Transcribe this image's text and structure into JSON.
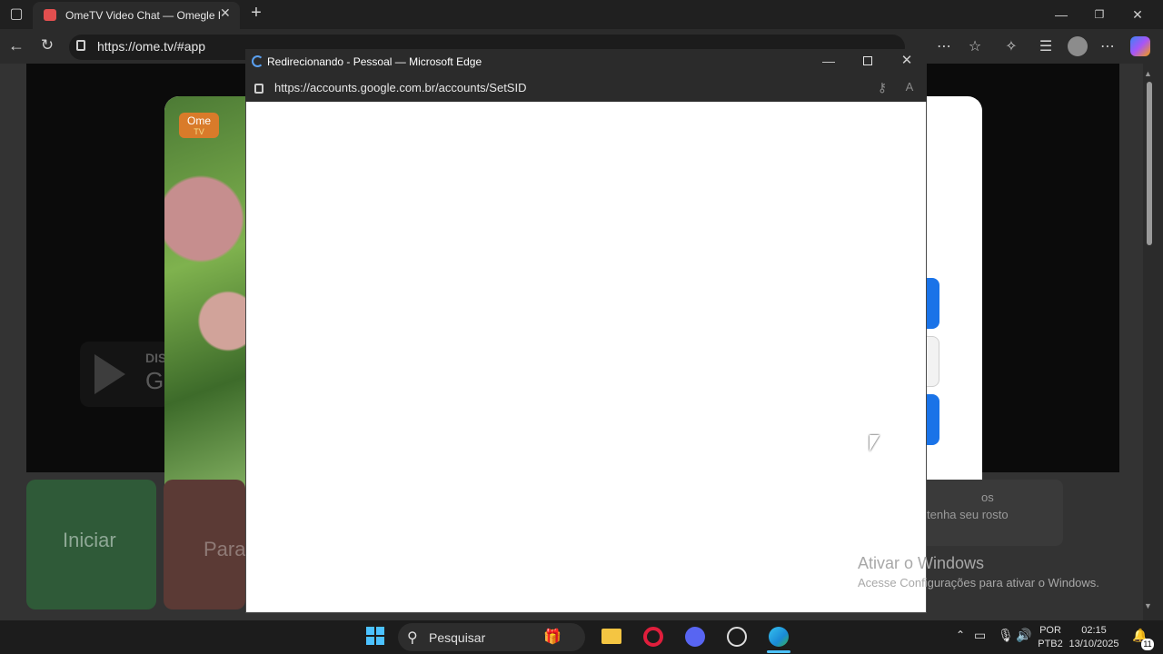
{
  "browser": {
    "tab_title": "OmeTV Video Chat — Omegle Ra",
    "url": "https://ome.tv/#app"
  },
  "page": {
    "logo_line1": "Ome",
    "logo_line2": "TV",
    "start_label": "Iniciar",
    "stop_label": "Para",
    "store_badge_line1": "DIS",
    "store_badge_line2": "G",
    "info_line1": "os",
    "info_line2": "tenha seu rosto"
  },
  "popup": {
    "title": "Redirecionando - Pessoal — Microsoft Edge",
    "url": "https://accounts.google.com.br/accounts/SetSID"
  },
  "watermark": {
    "title": "Ativar o Windows",
    "subtitle": "Acesse Configurações para ativar o Windows."
  },
  "taskbar": {
    "search_placeholder": "Pesquisar",
    "lang_line1": "POR",
    "lang_line2": "PTB2",
    "time": "02:15",
    "date": "13/10/2025",
    "notification_count": "11"
  },
  "colors": {
    "accent_blue": "#1a73e8",
    "edge_dark": "#2b2b2b"
  }
}
